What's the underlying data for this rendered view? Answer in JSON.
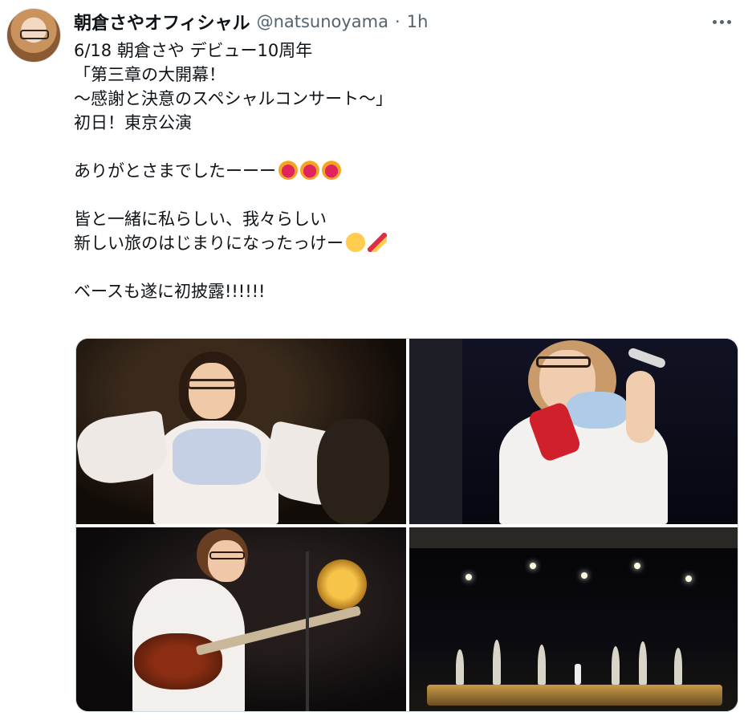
{
  "author": {
    "display_name": "朝倉さやオフィシャル",
    "handle": "@natsunoyama",
    "separator": "·",
    "time": "1h",
    "avatar_icon": "profile-avatar"
  },
  "more_icon": "more-horizontal-icon",
  "tweet": {
    "lines": [
      "6/18 朝倉さや デビュー10周年",
      "「第三章の大開幕！",
      "～感謝と決意のスペシャルコンサート～」",
      "初日！東京公演",
      "ありがとさまでしたーーー",
      "皆と一緒に私らしい、我々らしい",
      "新しい旅のはじまりになったっけー",
      "ベースも遂に初披露!!!!!!"
    ],
    "emoji": {
      "line5": [
        "heart-fire",
        "heart-fire",
        "heart-fire"
      ],
      "line7": [
        "tears-of-joy",
        "party-popper"
      ]
    }
  },
  "media": {
    "photos": [
      {
        "name": "photo-singer-white-dress"
      },
      {
        "name": "photo-singer-with-microphone"
      },
      {
        "name": "photo-singer-playing-bass"
      },
      {
        "name": "photo-concert-stage-wide"
      }
    ]
  },
  "colors": {
    "text": "#0f1419",
    "secondary": "#536471",
    "border": "#cfd9de"
  }
}
